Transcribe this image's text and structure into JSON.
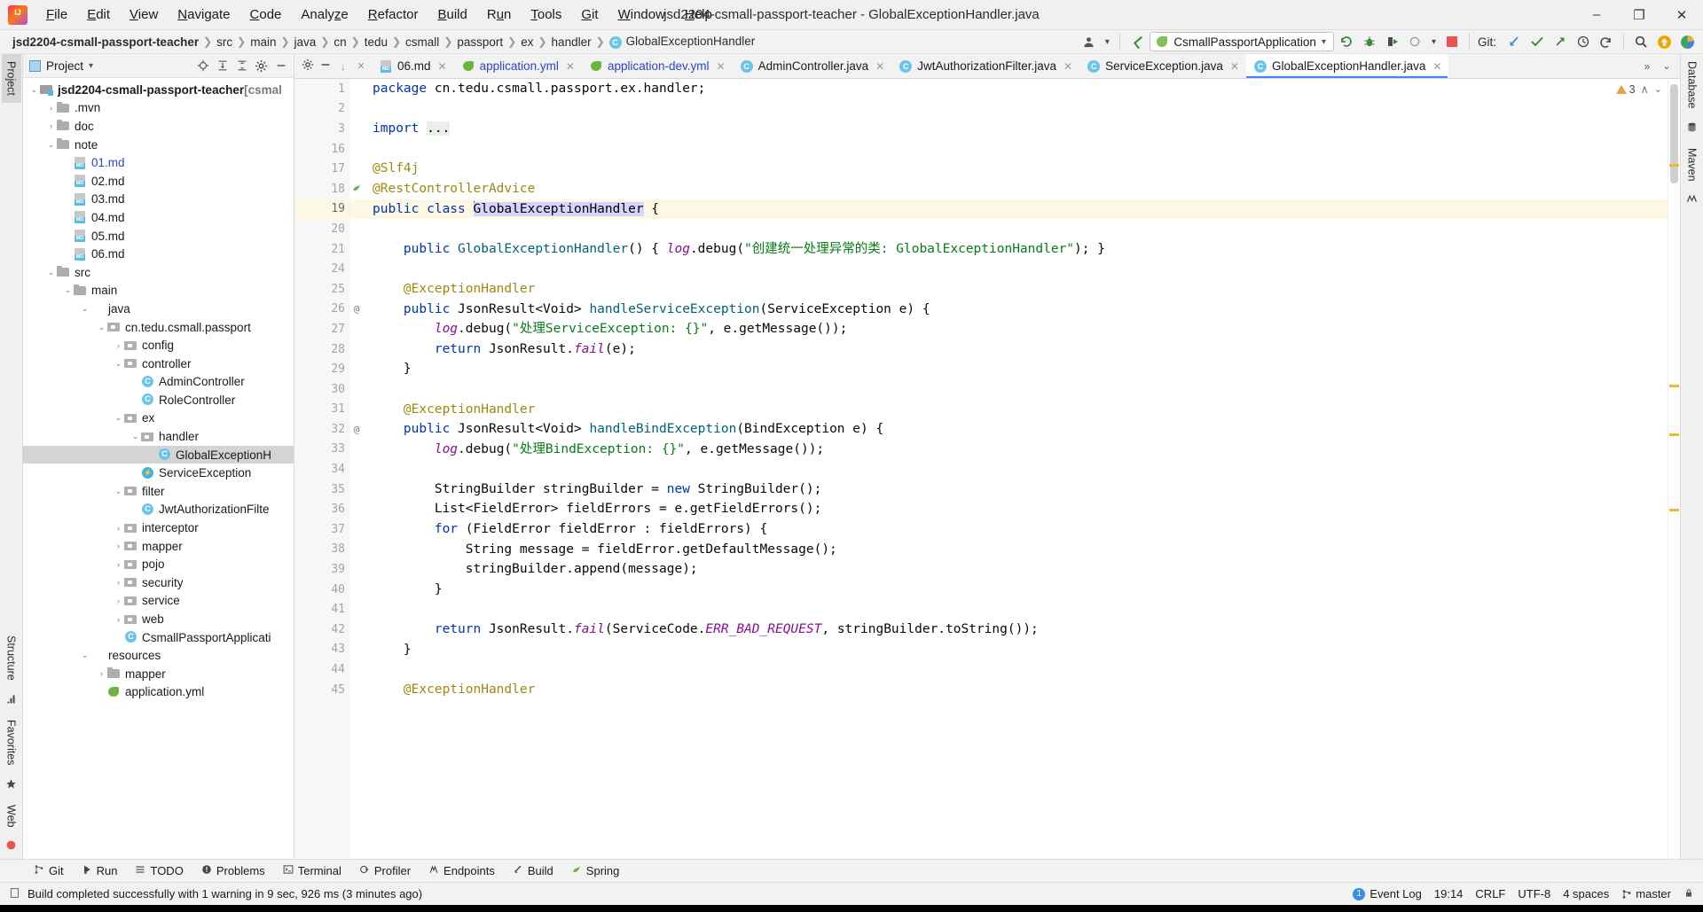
{
  "window": {
    "title": "jsd2204-csmall-passport-teacher - GlobalExceptionHandler.java",
    "logo": "intellij-idea-logo",
    "minimize": "–",
    "maximize": "❐",
    "close": "✕"
  },
  "menubar": [
    {
      "label": "File"
    },
    {
      "label": "Edit"
    },
    {
      "label": "View"
    },
    {
      "label": "Navigate"
    },
    {
      "label": "Code"
    },
    {
      "label": "Analyze"
    },
    {
      "label": "Refactor"
    },
    {
      "label": "Build"
    },
    {
      "label": "Run"
    },
    {
      "label": "Tools"
    },
    {
      "label": "Git"
    },
    {
      "label": "Window"
    },
    {
      "label": "Help"
    }
  ],
  "breadcrumb": [
    {
      "label": "jsd2204-csmall-passport-teacher",
      "bold": true
    },
    {
      "label": "src"
    },
    {
      "label": "main"
    },
    {
      "label": "java"
    },
    {
      "label": "cn"
    },
    {
      "label": "tedu"
    },
    {
      "label": "csmall"
    },
    {
      "label": "passport"
    },
    {
      "label": "ex"
    },
    {
      "label": "handler"
    },
    {
      "label": "GlobalExceptionHandler",
      "icon": "class-icon"
    }
  ],
  "toolbar": {
    "profile_icon": "user-profile-icon",
    "profile_caret": "▾",
    "back_icon": "checkmark-arrow-icon",
    "run_config": "CsmallPassportApplication",
    "run_config_caret": "▾",
    "rerun_icon": "rerun-icon",
    "debug_icon": "debug-bug-icon",
    "coverage_icon": "run-with-coverage-icon",
    "profile_run_icon": "profiler-icon",
    "profile_run_caret": "▾",
    "stop_icon": "stop-icon",
    "git_label": "Git:",
    "git_update_icon": "git-update-project-icon",
    "git_commit_icon": "git-commit-icon",
    "git_push_icon": "git-push-icon",
    "git_history_icon": "git-history-icon",
    "git_rollback_icon": "git-rollback-icon",
    "search_icon": "search-everywhere-icon",
    "update_icon": "update-available-icon",
    "ide_icon": "ide-features-icon"
  },
  "left_rail": [
    {
      "label": "Project",
      "active": true,
      "name": "rail-project"
    },
    {
      "label": "Structure",
      "active": false,
      "name": "rail-structure"
    },
    {
      "label": "Favorites",
      "active": false,
      "name": "rail-favorites"
    },
    {
      "label": "Web",
      "active": false,
      "name": "rail-web"
    }
  ],
  "right_rail": [
    {
      "label": "Database",
      "name": "rail-database"
    },
    {
      "label": "Maven",
      "name": "rail-maven"
    }
  ],
  "project_panel": {
    "title": "Project",
    "title_caret": "▾",
    "tools": {
      "locate_icon": "select-opened-file-icon",
      "expand_icon": "expand-all-icon",
      "collapse_icon": "collapse-all-icon",
      "settings_icon": "gear-icon",
      "hide_icon": "hide-panel-icon"
    },
    "tree": [
      {
        "depth": 0,
        "arrow": "⌄",
        "icon": "module",
        "label": "jsd2204-csmall-passport-teacher",
        "suffix": " [csmal",
        "bold": true
      },
      {
        "depth": 1,
        "arrow": "›",
        "icon": "folder",
        "label": ".mvn"
      },
      {
        "depth": 1,
        "arrow": "›",
        "icon": "folder",
        "label": "doc"
      },
      {
        "depth": 1,
        "arrow": "⌄",
        "icon": "folder",
        "label": "note"
      },
      {
        "depth": 2,
        "arrow": "",
        "icon": "md",
        "label": "01.md",
        "color": "blue"
      },
      {
        "depth": 2,
        "arrow": "",
        "icon": "md",
        "label": "02.md"
      },
      {
        "depth": 2,
        "arrow": "",
        "icon": "md",
        "label": "03.md"
      },
      {
        "depth": 2,
        "arrow": "",
        "icon": "md",
        "label": "04.md"
      },
      {
        "depth": 2,
        "arrow": "",
        "icon": "md",
        "label": "05.md"
      },
      {
        "depth": 2,
        "arrow": "",
        "icon": "md",
        "label": "06.md"
      },
      {
        "depth": 1,
        "arrow": "⌄",
        "icon": "folder",
        "label": "src"
      },
      {
        "depth": 2,
        "arrow": "⌄",
        "icon": "folder",
        "label": "main"
      },
      {
        "depth": 3,
        "arrow": "⌄",
        "icon": "folder-blue",
        "label": "java"
      },
      {
        "depth": 4,
        "arrow": "⌄",
        "icon": "pkg",
        "label": "cn.tedu.csmall.passport"
      },
      {
        "depth": 5,
        "arrow": "›",
        "icon": "pkg",
        "label": "config"
      },
      {
        "depth": 5,
        "arrow": "⌄",
        "icon": "pkg",
        "label": "controller"
      },
      {
        "depth": 6,
        "arrow": "",
        "icon": "cls",
        "label": "AdminController"
      },
      {
        "depth": 6,
        "arrow": "",
        "icon": "cls",
        "label": "RoleController"
      },
      {
        "depth": 5,
        "arrow": "⌄",
        "icon": "pkg",
        "label": "ex"
      },
      {
        "depth": 6,
        "arrow": "⌄",
        "icon": "pkg",
        "label": "handler"
      },
      {
        "depth": 7,
        "arrow": "",
        "icon": "cls",
        "label": "GlobalExceptionH",
        "selected": true
      },
      {
        "depth": 6,
        "arrow": "",
        "icon": "exc",
        "label": "ServiceException"
      },
      {
        "depth": 5,
        "arrow": "⌄",
        "icon": "pkg",
        "label": "filter"
      },
      {
        "depth": 6,
        "arrow": "",
        "icon": "cls",
        "label": "JwtAuthorizationFilte"
      },
      {
        "depth": 5,
        "arrow": "›",
        "icon": "pkg",
        "label": "interceptor"
      },
      {
        "depth": 5,
        "arrow": "›",
        "icon": "pkg",
        "label": "mapper"
      },
      {
        "depth": 5,
        "arrow": "›",
        "icon": "pkg",
        "label": "pojo"
      },
      {
        "depth": 5,
        "arrow": "›",
        "icon": "pkg",
        "label": "security"
      },
      {
        "depth": 5,
        "arrow": "›",
        "icon": "pkg",
        "label": "service"
      },
      {
        "depth": 5,
        "arrow": "›",
        "icon": "pkg",
        "label": "web"
      },
      {
        "depth": 5,
        "arrow": "",
        "icon": "app",
        "label": "CsmallPassportApplicati"
      },
      {
        "depth": 3,
        "arrow": "⌄",
        "icon": "folder-blue",
        "label": "resources"
      },
      {
        "depth": 4,
        "arrow": "›",
        "icon": "folder",
        "label": "mapper"
      },
      {
        "depth": 4,
        "arrow": "",
        "icon": "yml",
        "label": "application.yml"
      }
    ]
  },
  "tabs": {
    "lead": {
      "gear_icon": "gear-icon",
      "hide_icon": "hide-icon",
      "arrow_icon": "↓",
      "close_icon": "✕"
    },
    "items": [
      {
        "label": "06.md",
        "icon": "md",
        "active": false,
        "close": "✕"
      },
      {
        "label": "application.yml",
        "icon": "yml",
        "active": false,
        "color": "blue",
        "close": "✕"
      },
      {
        "label": "application-dev.yml",
        "icon": "yml",
        "active": false,
        "color": "blue",
        "close": "✕"
      },
      {
        "label": "AdminController.java",
        "icon": "cls",
        "active": false,
        "close": "✕"
      },
      {
        "label": "JwtAuthorizationFilter.java",
        "icon": "cls",
        "active": false,
        "close": "✕"
      },
      {
        "label": "ServiceException.java",
        "icon": "cls",
        "active": false,
        "close": "✕"
      },
      {
        "label": "GlobalExceptionHandler.java",
        "icon": "cls",
        "active": true,
        "close": "✕"
      }
    ],
    "overflow_icon": "»",
    "menu_icon": "⌄"
  },
  "editor": {
    "warning_count": "3",
    "warning_icon": "warning-triangle-icon",
    "inspection_caret": "⌄",
    "scroll_up_icon": "∧",
    "gutter_marks": {
      "18": "bean-icon",
      "19": "spring-bean-icon",
      "26": "override-icon",
      "32": "override-icon"
    },
    "lines": [
      {
        "n": "1",
        "tokens": [
          {
            "t": "package ",
            "c": "kw"
          },
          {
            "t": "cn.tedu.csmall.passport.ex.handler;",
            "c": "plain"
          }
        ]
      },
      {
        "n": "2",
        "tokens": []
      },
      {
        "n": "3",
        "tokens": [
          {
            "t": "import ",
            "c": "kw"
          },
          {
            "t": "...",
            "c": "fold"
          }
        ],
        "foldplus": true
      },
      {
        "n": "16",
        "tokens": []
      },
      {
        "n": "17",
        "tokens": [
          {
            "t": "@Slf4j",
            "c": "ann"
          }
        ]
      },
      {
        "n": "18",
        "tokens": [
          {
            "t": "@RestControllerAdvice",
            "c": "ann"
          }
        ]
      },
      {
        "n": "19",
        "tokens": [
          {
            "t": "public ",
            "c": "kw"
          },
          {
            "t": "class ",
            "c": "kw"
          },
          {
            "t": "GlobalExceptionHandler",
            "c": "sel-hl"
          },
          {
            "t": " {",
            "c": "plain"
          }
        ],
        "current": true
      },
      {
        "n": "20",
        "tokens": []
      },
      {
        "n": "21",
        "tokens": [
          {
            "t": "    ",
            "c": "plain"
          },
          {
            "t": "public ",
            "c": "kw"
          },
          {
            "t": "GlobalExceptionHandler",
            "c": "mth"
          },
          {
            "t": "() { ",
            "c": "plain"
          },
          {
            "t": "log",
            "c": "fld"
          },
          {
            "t": ".debug(",
            "c": "plain"
          },
          {
            "t": "\"创建统一处理异常的类: GlobalExceptionHandler\"",
            "c": "str"
          },
          {
            "t": "); }",
            "c": "plain"
          }
        ]
      },
      {
        "n": "24",
        "tokens": []
      },
      {
        "n": "25",
        "tokens": [
          {
            "t": "    ",
            "c": "plain"
          },
          {
            "t": "@ExceptionHandler",
            "c": "ann"
          }
        ]
      },
      {
        "n": "26",
        "tokens": [
          {
            "t": "    ",
            "c": "plain"
          },
          {
            "t": "public ",
            "c": "kw"
          },
          {
            "t": "JsonResult<Void> ",
            "c": "plain"
          },
          {
            "t": "handleServiceException",
            "c": "mth"
          },
          {
            "t": "(ServiceException e) {",
            "c": "plain"
          }
        ]
      },
      {
        "n": "27",
        "tokens": [
          {
            "t": "        ",
            "c": "plain"
          },
          {
            "t": "log",
            "c": "fld"
          },
          {
            "t": ".debug(",
            "c": "plain"
          },
          {
            "t": "\"处理ServiceException: {}\"",
            "c": "str"
          },
          {
            "t": ", e.getMessage());",
            "c": "plain"
          }
        ]
      },
      {
        "n": "28",
        "tokens": [
          {
            "t": "        ",
            "c": "plain"
          },
          {
            "t": "return ",
            "c": "kw"
          },
          {
            "t": "JsonResult.",
            "c": "plain"
          },
          {
            "t": "fail",
            "c": "cst"
          },
          {
            "t": "(e);",
            "c": "plain"
          }
        ]
      },
      {
        "n": "29",
        "tokens": [
          {
            "t": "    }",
            "c": "plain"
          }
        ]
      },
      {
        "n": "30",
        "tokens": []
      },
      {
        "n": "31",
        "tokens": [
          {
            "t": "    ",
            "c": "plain"
          },
          {
            "t": "@ExceptionHandler",
            "c": "ann"
          }
        ]
      },
      {
        "n": "32",
        "tokens": [
          {
            "t": "    ",
            "c": "plain"
          },
          {
            "t": "public ",
            "c": "kw"
          },
          {
            "t": "JsonResult<Void> ",
            "c": "plain"
          },
          {
            "t": "handleBindException",
            "c": "mth"
          },
          {
            "t": "(BindException e) {",
            "c": "plain"
          }
        ]
      },
      {
        "n": "33",
        "tokens": [
          {
            "t": "        ",
            "c": "plain"
          },
          {
            "t": "log",
            "c": "fld"
          },
          {
            "t": ".debug(",
            "c": "plain"
          },
          {
            "t": "\"处理BindException: {}\"",
            "c": "str"
          },
          {
            "t": ", e.getMessage());",
            "c": "plain"
          }
        ]
      },
      {
        "n": "34",
        "tokens": []
      },
      {
        "n": "35",
        "tokens": [
          {
            "t": "        StringBuilder stringBuilder = ",
            "c": "plain"
          },
          {
            "t": "new ",
            "c": "kw"
          },
          {
            "t": "StringBuilder();",
            "c": "plain"
          }
        ]
      },
      {
        "n": "36",
        "tokens": [
          {
            "t": "        List<FieldError> fieldErrors = e.getFieldErrors();",
            "c": "plain"
          }
        ]
      },
      {
        "n": "37",
        "tokens": [
          {
            "t": "        ",
            "c": "plain"
          },
          {
            "t": "for ",
            "c": "kw"
          },
          {
            "t": "(FieldError fieldError : fieldErrors) {",
            "c": "plain"
          }
        ]
      },
      {
        "n": "38",
        "tokens": [
          {
            "t": "            String message = fieldError.getDefaultMessage();",
            "c": "plain"
          }
        ]
      },
      {
        "n": "39",
        "tokens": [
          {
            "t": "            stringBuilder.append(message);",
            "c": "plain"
          }
        ]
      },
      {
        "n": "40",
        "tokens": [
          {
            "t": "        }",
            "c": "plain"
          }
        ]
      },
      {
        "n": "41",
        "tokens": []
      },
      {
        "n": "42",
        "tokens": [
          {
            "t": "        ",
            "c": "plain"
          },
          {
            "t": "return ",
            "c": "kw"
          },
          {
            "t": "JsonResult.",
            "c": "plain"
          },
          {
            "t": "fail",
            "c": "cst"
          },
          {
            "t": "(ServiceCode.",
            "c": "plain"
          },
          {
            "t": "ERR_BAD_REQUEST",
            "c": "cst"
          },
          {
            "t": ", stringBuilder.toString());",
            "c": "plain"
          }
        ]
      },
      {
        "n": "43",
        "tokens": [
          {
            "t": "    }",
            "c": "plain"
          }
        ]
      },
      {
        "n": "44",
        "tokens": []
      },
      {
        "n": "45",
        "tokens": [
          {
            "t": "    ",
            "c": "plain"
          },
          {
            "t": "@ExceptionHandler",
            "c": "ann"
          }
        ]
      }
    ]
  },
  "toolwindows": [
    {
      "label": "Git",
      "icon": "git-branch-icon"
    },
    {
      "label": "Run",
      "icon": "run-icon"
    },
    {
      "label": "TODO",
      "icon": "todo-icon"
    },
    {
      "label": "Problems",
      "icon": "problems-icon"
    },
    {
      "label": "Terminal",
      "icon": "terminal-icon"
    },
    {
      "label": "Profiler",
      "icon": "profiler-icon"
    },
    {
      "label": "Endpoints",
      "icon": "endpoints-icon"
    },
    {
      "label": "Build",
      "icon": "build-icon"
    },
    {
      "label": "Spring",
      "icon": "spring-icon"
    }
  ],
  "statusbar": {
    "message_icon": "message-icon",
    "message": "Build completed successfully with 1 warning in 9 sec, 926 ms (3 minutes ago)",
    "event_log_icon": "event-log-icon",
    "event_log": "Event Log",
    "caret_position": "19:14",
    "line_separator": "CRLF",
    "encoding": "UTF-8",
    "indent": "4 spaces",
    "branch_icon": "git-branch-icon",
    "branch": "master",
    "lock_icon": "lock-icon"
  },
  "colors": {
    "accent_blue": "#4287f5",
    "keyword": "#0033b3",
    "string": "#067d17",
    "annotation": "#9e880d",
    "method": "#00627a",
    "field": "#871094",
    "selection": "#d4d4ff",
    "current_line": "#fdf8e3",
    "spring_green": "#6db33f",
    "class_icon_blue": "#6cc5e8"
  }
}
